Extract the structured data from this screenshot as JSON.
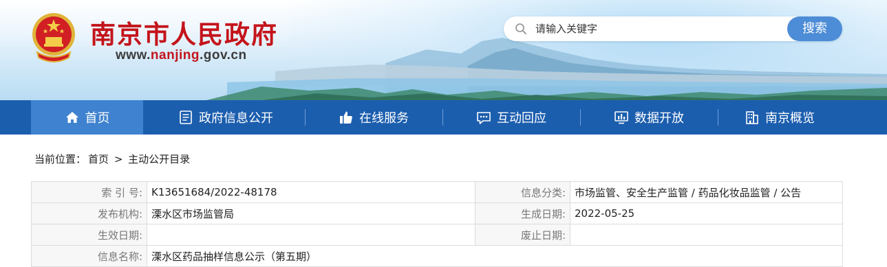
{
  "header": {
    "site_title": "南京市人民政府",
    "site_url_prefix": "www.",
    "site_url_highlight": "nanjing",
    "site_url_suffix": ".gov.cn",
    "emblem_icon": "national-emblem-icon"
  },
  "search": {
    "placeholder": "请输入关键字",
    "button_label": "搜索"
  },
  "nav": {
    "items": [
      {
        "label": "首页",
        "icon": "home-icon",
        "active": true
      },
      {
        "label": "政府信息公开",
        "icon": "document-icon",
        "active": false
      },
      {
        "label": "在线服务",
        "icon": "thumbs-up-icon",
        "active": false
      },
      {
        "label": "互动回应",
        "icon": "chat-icon",
        "active": false
      },
      {
        "label": "数据开放",
        "icon": "data-chart-icon",
        "active": false
      },
      {
        "label": "南京概览",
        "icon": "building-icon",
        "active": false
      }
    ]
  },
  "breadcrumb": {
    "prefix": "当前位置：",
    "home": "首页",
    "separator": ">",
    "current": "主动公开目录"
  },
  "info": {
    "index_label": "索 引 号:",
    "index_value": "K13651684/2022-48178",
    "category_label": "信息分类:",
    "category_value": "市场监管、安全生产监管 / 药品化妆品监管 / 公告",
    "publisher_label": "发布机构:",
    "publisher_value": "溧水区市场监管局",
    "created_label": "生成日期:",
    "created_value": "2022-05-25",
    "effective_label": "生效日期:",
    "effective_value": "",
    "abolished_label": "废止日期:",
    "abolished_value": "",
    "name_label": "信息名称:",
    "name_value": "溧水区药品抽样信息公示（第五期）"
  },
  "colors": {
    "brand_red": "#c4141b",
    "nav_blue": "#1c5eae",
    "nav_active": "#3f82cf",
    "search_button": "#4d8cd6"
  }
}
